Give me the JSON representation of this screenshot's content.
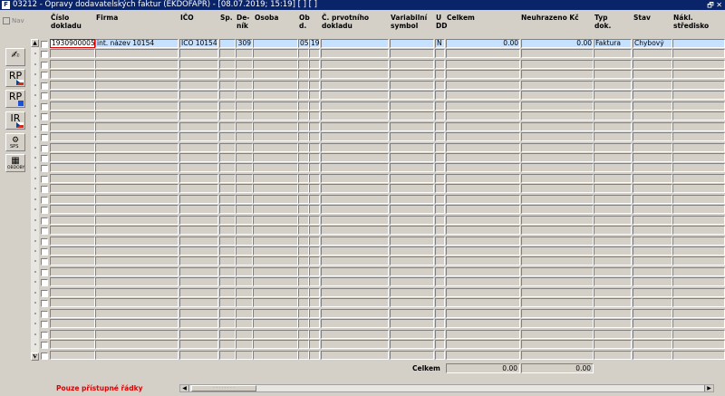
{
  "window": {
    "title": "03212 - Opravy dodavatelských faktur (EKDOFAPR) - [08.07.2019; 15:19]  [ ]  [ ]",
    "app_icon": "app-logo-icon",
    "restore_label": "🗗 ✕"
  },
  "toolbar": {
    "nav_label": "Nav",
    "buttons": [
      {
        "name": "sign-document-icon",
        "label": "✍"
      },
      {
        "name": "rp-cz-button",
        "label": "RP"
      },
      {
        "name": "rp-blue-button",
        "label": "RP"
      },
      {
        "name": "ir-cz-button",
        "label": "IR"
      },
      {
        "name": "sps-button",
        "label": "SPS"
      },
      {
        "name": "obdoby-button",
        "label": "OBDOBY"
      }
    ]
  },
  "columns": {
    "cislo_dokladu": "Číslo\ndokladu",
    "firma": "Firma",
    "ico": "IČO",
    "sp": "Sp.",
    "denik": "De-\nník",
    "osoba": "Osoba",
    "obd": "Ob\nd.",
    "c_prvotniho": "Č. prvotního\ndokladu",
    "variabilni": "Variabilní\nsymbol",
    "udd": "U\nDD",
    "celkem": "Celkem",
    "neuhrazeno": "Neuhrazeno Kč",
    "typ_dok": "Typ\ndok.",
    "stav": "Stav",
    "nakl": "Nákl.\nstředisko"
  },
  "rows": [
    {
      "cislo": "1930900005",
      "firma": "int. název 10154",
      "ico": "IČO 10154",
      "sp": "",
      "denik": "309",
      "osoba": "",
      "obd": "05",
      "obd2": "19",
      "c_prv": "",
      "var": "",
      "udd": "N",
      "celkem": "0.00",
      "neuhr": "0.00",
      "typ": "Faktura",
      "stav": "Chybový",
      "nakl": ""
    }
  ],
  "empty_row_count": 30,
  "totals": {
    "label": "Celkem",
    "celkem": "0.00",
    "neuhrazeno": "0.00"
  },
  "status_text": "Pouze přístupné řádky",
  "colors": {
    "titlebar": "#0a246a",
    "selection": "#c6e0ff",
    "status": "#e00000"
  }
}
